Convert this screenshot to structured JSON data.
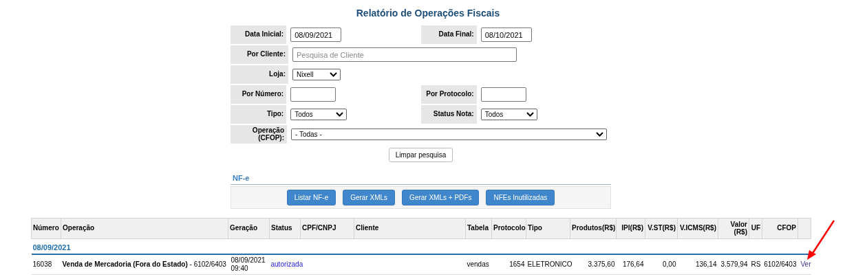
{
  "title": "Relatório de Operações Fiscais",
  "form_rows": [
    [
      {
        "label": "Data Inicial:",
        "kind": "input",
        "value": "08/09/2021"
      },
      {
        "label": "Data Final:",
        "kind": "input",
        "value": "08/10/2021"
      }
    ],
    [
      {
        "label": "Por Cliente:",
        "kind": "input",
        "placeholder": "Pesquisa de Cliente"
      }
    ],
    [
      {
        "label": "Loja:",
        "kind": "select",
        "value": "Nixell"
      }
    ],
    [
      {
        "label": "Por Número:",
        "kind": "input"
      },
      {
        "label": "Por Protocolo:",
        "kind": "input"
      }
    ],
    [
      {
        "label": "Tipo:",
        "kind": "select",
        "value": "Todos"
      },
      {
        "label": "Status Nota:",
        "kind": "select",
        "value": "Todos"
      }
    ],
    [
      {
        "label": "Operação (CFOP):",
        "kind": "select",
        "value": "- Todas -"
      }
    ]
  ],
  "clear_button": "Limpar pesquisa",
  "section_title": "NF-e",
  "actions": [
    "Listar NF-e",
    "Gerar XMLs",
    "Gerar XMLs + PDFs",
    "NFEs Inutilizadas"
  ],
  "table": {
    "columns": [
      "Número",
      "Operação",
      "Geração",
      "Status",
      "CPF/CNPJ",
      "Cliente",
      "Tabela",
      "Protocolo",
      "Tipo",
      "Produtos(R$)",
      "IPI(R$)",
      "V.ST(R$)",
      "V.ICMS(R$)",
      "Valor (R$)",
      "UF",
      "CFOP"
    ],
    "groups": [
      {
        "date": "08/09/2021",
        "rows": [
          {
            "numero": "16038",
            "operacao": "**Venda de Mercadoria (Fora do Estado)** - 6102/6403",
            "geracao": "08/09/2021 09:40",
            "status": "autorizada",
            "tabela": "vendas",
            "protocolo": "1654",
            "tipo": "ELETRONICO",
            "produtos": "3.375,60",
            "ipi": "176,64",
            "vst": "0,00",
            "vicms": "136,14",
            "valor": "3.579,94",
            "uf": "RS",
            "cfop": "6102/6403",
            "link": "Ver"
          }
        ]
      }
    ]
  }
}
